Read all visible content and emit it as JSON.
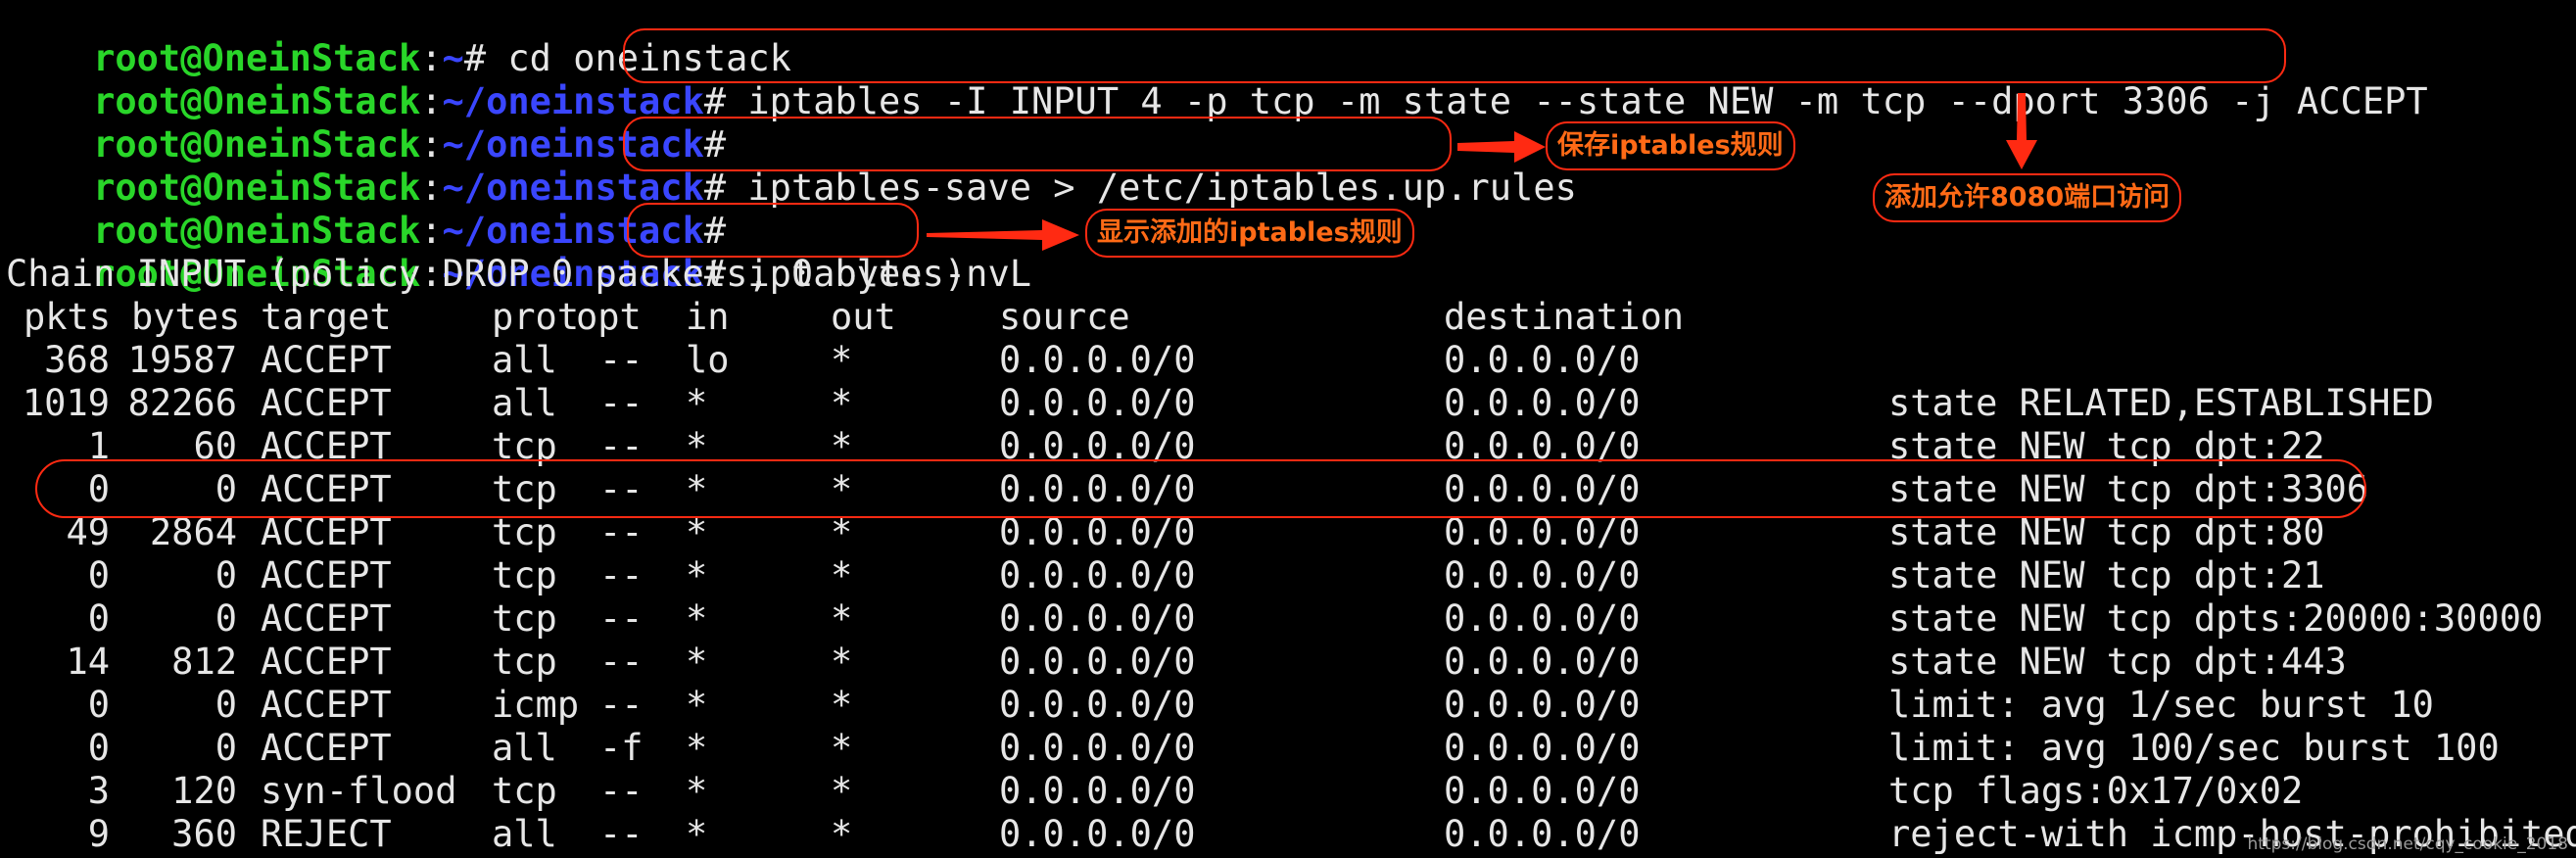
{
  "prompt": {
    "user": "root@OneinStack",
    "colon": ":",
    "home_path": "~",
    "repo_path": "~/oneinstack",
    "symbol": "#"
  },
  "commands": [
    "cd oneinstack",
    "iptables -I INPUT 4 -p tcp -m state --state NEW -m tcp --dport 3306 -j ACCEPT",
    "",
    "iptables-save > /etc/iptables.up.rules",
    "",
    "iptables -nvL"
  ],
  "annotations": {
    "save_rules": "保存iptables规则",
    "allow_port": "添加允许8080端口访问",
    "show_rules": "显示添加的iptables规则"
  },
  "chain_header": "Chain INPUT (policy DROP 0 packets, 0 bytes)",
  "table": {
    "columns": [
      "pkts",
      "bytes",
      "target",
      "prot",
      "opt",
      "in",
      "out",
      "source",
      "destination",
      ""
    ],
    "rows": [
      {
        "pkts": "368",
        "bytes": "19587",
        "target": "ACCEPT",
        "prot": "all",
        "opt": "--",
        "in": "lo",
        "out": "*",
        "source": "0.0.0.0/0",
        "destination": "0.0.0.0/0",
        "extra": ""
      },
      {
        "pkts": "1019",
        "bytes": "82266",
        "target": "ACCEPT",
        "prot": "all",
        "opt": "--",
        "in": "*",
        "out": "*",
        "source": "0.0.0.0/0",
        "destination": "0.0.0.0/0",
        "extra": "state RELATED,ESTABLISHED"
      },
      {
        "pkts": "1",
        "bytes": "60",
        "target": "ACCEPT",
        "prot": "tcp",
        "opt": "--",
        "in": "*",
        "out": "*",
        "source": "0.0.0.0/0",
        "destination": "0.0.0.0/0",
        "extra": "state NEW tcp dpt:22"
      },
      {
        "pkts": "0",
        "bytes": "0",
        "target": "ACCEPT",
        "prot": "tcp",
        "opt": "--",
        "in": "*",
        "out": "*",
        "source": "0.0.0.0/0",
        "destination": "0.0.0.0/0",
        "extra": "state NEW tcp dpt:3306"
      },
      {
        "pkts": "49",
        "bytes": "2864",
        "target": "ACCEPT",
        "prot": "tcp",
        "opt": "--",
        "in": "*",
        "out": "*",
        "source": "0.0.0.0/0",
        "destination": "0.0.0.0/0",
        "extra": "state NEW tcp dpt:80"
      },
      {
        "pkts": "0",
        "bytes": "0",
        "target": "ACCEPT",
        "prot": "tcp",
        "opt": "--",
        "in": "*",
        "out": "*",
        "source": "0.0.0.0/0",
        "destination": "0.0.0.0/0",
        "extra": "state NEW tcp dpt:21"
      },
      {
        "pkts": "0",
        "bytes": "0",
        "target": "ACCEPT",
        "prot": "tcp",
        "opt": "--",
        "in": "*",
        "out": "*",
        "source": "0.0.0.0/0",
        "destination": "0.0.0.0/0",
        "extra": "state NEW tcp dpts:20000:30000"
      },
      {
        "pkts": "14",
        "bytes": "812",
        "target": "ACCEPT",
        "prot": "tcp",
        "opt": "--",
        "in": "*",
        "out": "*",
        "source": "0.0.0.0/0",
        "destination": "0.0.0.0/0",
        "extra": "state NEW tcp dpt:443"
      },
      {
        "pkts": "0",
        "bytes": "0",
        "target": "ACCEPT",
        "prot": "icmp",
        "opt": "--",
        "in": "*",
        "out": "*",
        "source": "0.0.0.0/0",
        "destination": "0.0.0.0/0",
        "extra": "limit: avg 1/sec burst 10"
      },
      {
        "pkts": "0",
        "bytes": "0",
        "target": "ACCEPT",
        "prot": "all",
        "opt": "-f",
        "in": "*",
        "out": "*",
        "source": "0.0.0.0/0",
        "destination": "0.0.0.0/0",
        "extra": "limit: avg 100/sec burst 100"
      },
      {
        "pkts": "3",
        "bytes": "120",
        "target": "syn-flood",
        "prot": "tcp",
        "opt": "--",
        "in": "*",
        "out": "*",
        "source": "0.0.0.0/0",
        "destination": "0.0.0.0/0",
        "extra": "tcp flags:0x17/0x02"
      },
      {
        "pkts": "9",
        "bytes": "360",
        "target": "REJECT",
        "prot": "all",
        "opt": "--",
        "in": "*",
        "out": "*",
        "source": "0.0.0.0/0",
        "destination": "0.0.0.0/0",
        "extra": "reject-with icmp-host-prohibited"
      }
    ]
  },
  "watermark": "https://blog.csdn.net/cqy_cookie_2018",
  "colors": {
    "prompt_user": "#29d629",
    "prompt_path": "#3a46ff",
    "annotation_border": "#ff2a12",
    "annotation_text": "#ff6a16"
  }
}
